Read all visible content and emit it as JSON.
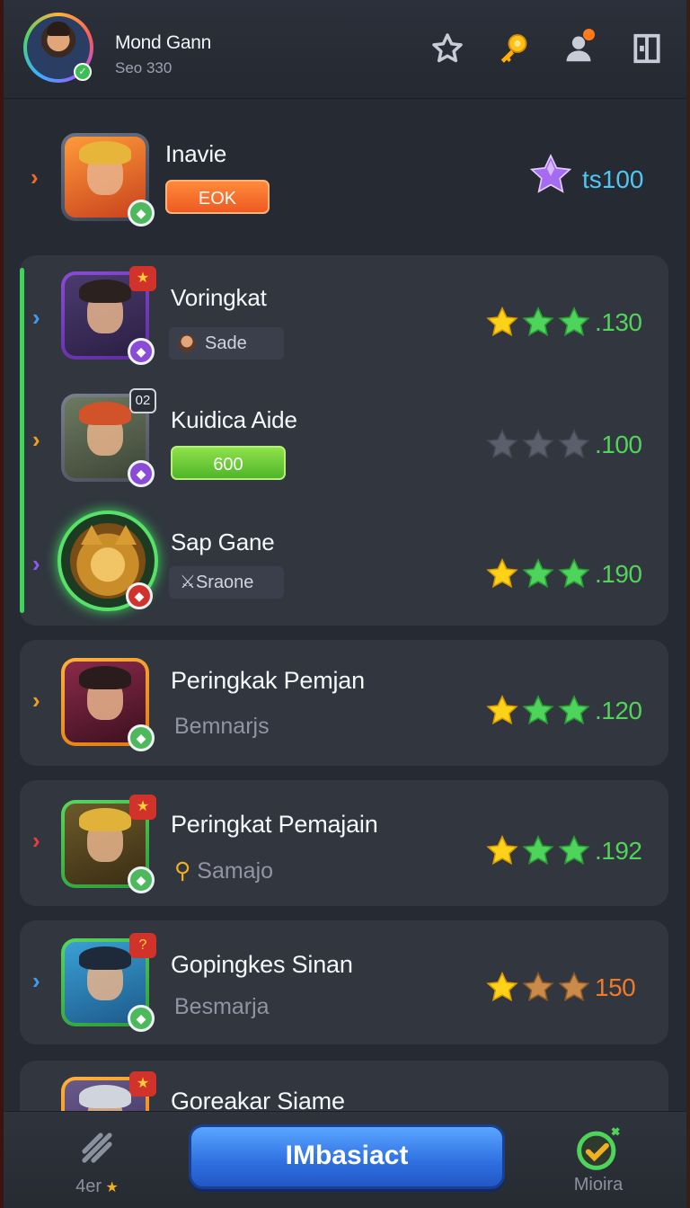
{
  "header": {
    "user_name": "Mond Gann",
    "user_sub": "Seo 330",
    "icons": [
      "star-outline-icon",
      "key-icon",
      "profile-icon",
      "exit-icon"
    ]
  },
  "featured": {
    "title": "Inavie",
    "button_label": "EOK",
    "gem_value": "ts100",
    "gem_icon": "purple-star-gem-icon"
  },
  "group": {
    "items": [
      {
        "title": "Voringkat",
        "chip": "Sade",
        "stars": [
          "gold",
          "green",
          "green"
        ],
        "score": ".130",
        "score_color": "#52d45a",
        "arrow_color": "#3f9cf0"
      },
      {
        "title": "Kuidica Aide",
        "pill": "600",
        "badge_top": "02",
        "stars": [
          "grey",
          "grey",
          "grey"
        ],
        "score": ".100",
        "score_color": "#52d45a",
        "arrow_color": "#f0a020"
      },
      {
        "title": "Sap Gane",
        "chip": "Sraone",
        "stars": [
          "gold",
          "green",
          "green"
        ],
        "score": ".190",
        "score_color": "#52d45a",
        "arrow_color": "#8c5cf0"
      }
    ]
  },
  "cards": [
    {
      "title": "Peringkak Pemjan",
      "subtitle": "Bemnarjs",
      "stars": [
        "gold",
        "green",
        "green"
      ],
      "score": ".120",
      "score_color": "#52d45a",
      "arrow_color": "#f0a020"
    },
    {
      "title": "Peringkat Pemajain",
      "subtitle": "Samajo",
      "stars": [
        "gold",
        "green",
        "green"
      ],
      "score": ".192",
      "score_color": "#52d45a",
      "arrow_color": "#e8403a"
    },
    {
      "title": "Gopingkes Sinan",
      "subtitle": "Besmarja",
      "badge_top": "?",
      "stars": [
        "gold",
        "bronze",
        "bronze"
      ],
      "score": "150",
      "score_color": "#f07a2a",
      "arrow_color": "#3f9cf0"
    },
    {
      "title": "Goreakar Siame"
    }
  ],
  "bottom": {
    "left_label": "4er",
    "main_button": "IMbasiact",
    "right_label": "Mioira"
  }
}
